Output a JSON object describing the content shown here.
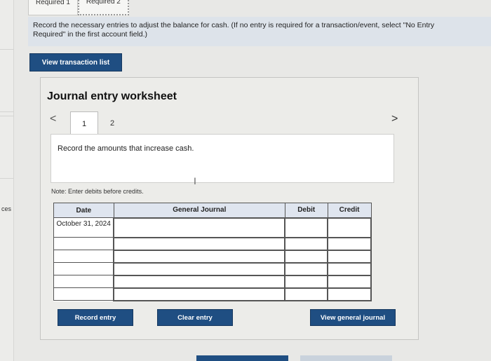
{
  "tabs": [
    {
      "label": "Required 1"
    },
    {
      "label": "Required 2"
    }
  ],
  "instructions": {
    "line1": "Record the necessary entries to adjust the balance for cash. (If no entry is required for a transaction/event, select \"No Entry",
    "line2": "Required\" in the first account field.)"
  },
  "view_transaction_list": "View transaction list",
  "side_label": "ces",
  "worksheet": {
    "title": "Journal entry worksheet",
    "nav_prev": "<",
    "nav_next": ">",
    "steps": [
      "1",
      "2"
    ],
    "prompt": "Record the amounts that increase cash.",
    "note": "Note: Enter debits before credits."
  },
  "journal": {
    "headers": [
      "Date",
      "General Journal",
      "Debit",
      "Credit"
    ],
    "first_date": "October 31, 2024"
  },
  "buttons": {
    "record": "Record entry",
    "clear": "Clear entry",
    "view_gj": "View general journal"
  },
  "colors": {
    "primary": "#1f4e82",
    "header_bg": "#dfe5ef",
    "instructions_bg": "#dde3ea"
  }
}
